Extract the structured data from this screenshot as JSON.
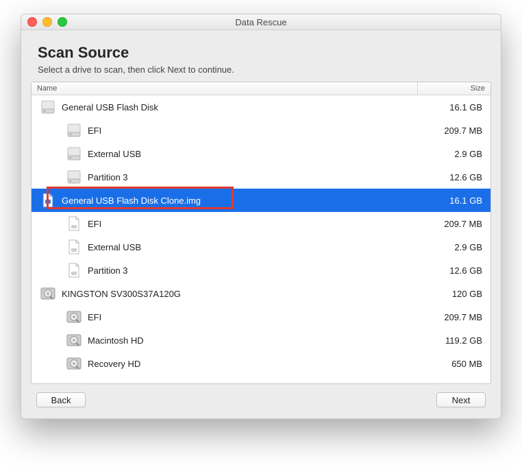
{
  "window": {
    "title": "Data Rescue"
  },
  "heading": "Scan Source",
  "subheading": "Select a drive to scan, then click Next to continue.",
  "columns": {
    "name": "Name",
    "size": "Size"
  },
  "rows": [
    {
      "name": "General USB Flash Disk",
      "size": "16.1 GB",
      "indent": 0,
      "icon": "ext-disk",
      "selected": false
    },
    {
      "name": "EFI",
      "size": "209.7 MB",
      "indent": 1,
      "icon": "ext-disk",
      "selected": false
    },
    {
      "name": "External USB",
      "size": "2.9 GB",
      "indent": 1,
      "icon": "ext-disk",
      "selected": false
    },
    {
      "name": "Partition 3",
      "size": "12.6 GB",
      "indent": 1,
      "icon": "ext-disk",
      "selected": false
    },
    {
      "name": "General USB Flash Disk Clone.img",
      "size": "16.1 GB",
      "indent": 0,
      "icon": "img-file",
      "selected": true,
      "highlight": true
    },
    {
      "name": "EFI",
      "size": "209.7 MB",
      "indent": 1,
      "icon": "doc",
      "selected": false
    },
    {
      "name": "External USB",
      "size": "2.9 GB",
      "indent": 1,
      "icon": "doc",
      "selected": false
    },
    {
      "name": "Partition 3",
      "size": "12.6 GB",
      "indent": 1,
      "icon": "doc",
      "selected": false
    },
    {
      "name": "KINGSTON SV300S37A120G",
      "size": "120 GB",
      "indent": 0,
      "icon": "int-disk",
      "selected": false
    },
    {
      "name": "EFI",
      "size": "209.7 MB",
      "indent": 1,
      "icon": "int-disk",
      "selected": false
    },
    {
      "name": "Macintosh HD",
      "size": "119.2 GB",
      "indent": 1,
      "icon": "int-disk",
      "selected": false
    },
    {
      "name": "Recovery HD",
      "size": "650 MB",
      "indent": 1,
      "icon": "int-disk",
      "selected": false
    }
  ],
  "buttons": {
    "back": "Back",
    "next": "Next"
  }
}
